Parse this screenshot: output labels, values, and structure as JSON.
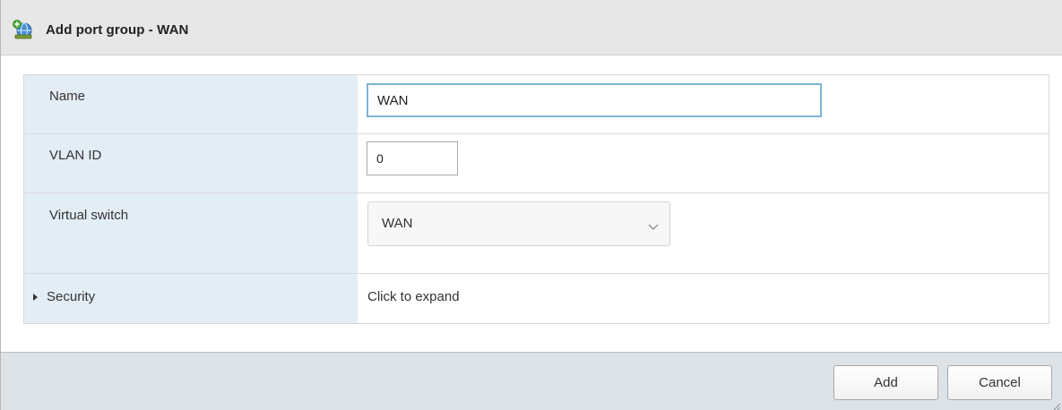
{
  "dialog": {
    "title": "Add port group - WAN",
    "title_icon": "network-add-icon"
  },
  "form": {
    "name": {
      "label": "Name",
      "value": "WAN"
    },
    "vlan_id": {
      "label": "VLAN ID",
      "value": "0"
    },
    "virtual_switch": {
      "label": "Virtual switch",
      "selected": "WAN"
    },
    "security": {
      "label": "Security",
      "expand_text": "Click to expand"
    }
  },
  "footer": {
    "add_label": "Add",
    "cancel_label": "Cancel"
  },
  "colors": {
    "label_background": "#e3edf6",
    "focus_border": "#7db4d6",
    "footer_background": "#dde2e7",
    "titlebar_background": "#e7e7e7"
  }
}
